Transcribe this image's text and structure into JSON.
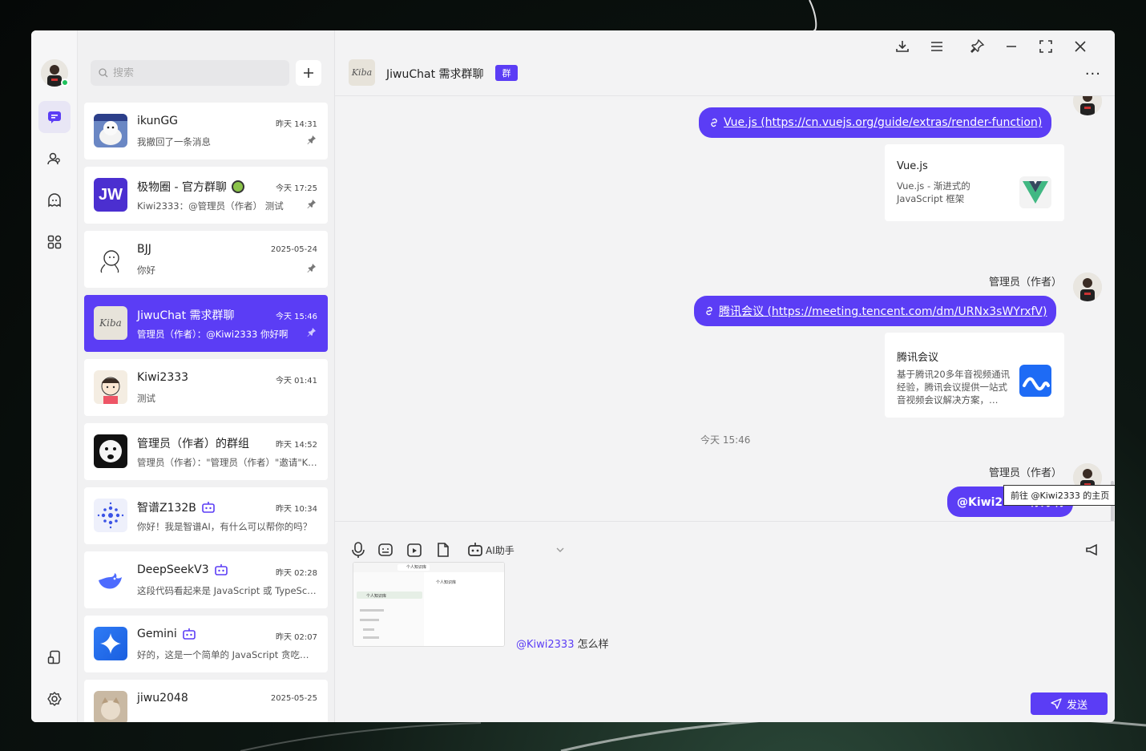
{
  "sidebar": {
    "status": "online"
  },
  "search": {
    "placeholder": "搜索"
  },
  "sessions": [
    {
      "name": "ikunGG",
      "time": "昨天 14:31",
      "preview": "我撤回了一条消息",
      "pinned": true
    },
    {
      "name": "极物圈 - 官方群聊",
      "time": "今天 17:25",
      "preview": "Kiwi2333：@管理员（作者） 测试",
      "pinned": true,
      "avatar_text": "JW"
    },
    {
      "name": "BJJ",
      "time": "2025-05-24",
      "preview": "你好",
      "pinned": true
    },
    {
      "name": "JiwuChat 需求群聊",
      "time": "今天 15:46",
      "preview": "管理员（作者）：@Kiwi2333 你好啊",
      "pinned": true,
      "active": true
    },
    {
      "name": "Kiwi2333",
      "time": "今天 01:41",
      "preview": "测试"
    },
    {
      "name": "管理员（作者）的群组",
      "time": "昨天 14:52",
      "preview": "管理员（作者）：\"管理员（作者）\"邀请\"Kiwi2333\"加入群聊"
    },
    {
      "name": "智谱Z132B",
      "time": "昨天 10:34",
      "preview": "你好！我是智谱AI，有什么可以帮你的吗？",
      "bot": true
    },
    {
      "name": "DeepSeekV3",
      "time": "昨天 02:28",
      "preview": "这段代码看起来是 JavaScript 或 TypeScript",
      "bot": true
    },
    {
      "name": "Gemini",
      "time": "昨天 02:07",
      "preview": "好的，这是一个简单的 JavaScript 贪吃蛇游戏",
      "bot": true
    },
    {
      "name": "jiwu2048",
      "time": "2025-05-25",
      "preview": ""
    }
  ],
  "chat": {
    "title": "JiwuChat 需求群聊",
    "badge": "群",
    "avatar_text": "Kiba",
    "more": "···"
  },
  "messages": {
    "link1": "Vue.js (https://cn.vuejs.org/guide/extras/render-function)",
    "card1": {
      "title": "Vue.js",
      "desc": "Vue.js - 渐进式的 JavaScript 框架"
    },
    "sender2": "管理员（作者）",
    "link2": "腾讯会议 (https://meeting.tencent.com/dm/URNx3sWYrxfV)",
    "card2": {
      "title": "腾讯会议",
      "desc": "基于腾讯20多年音视频通讯经验，腾讯会议提供一站式音视频会议解决方案，…"
    },
    "time_divider": "今天 15:46",
    "sender3": "管理员（作者）",
    "text3": "@Kiwi2333 你好啊",
    "tooltip": "前往 @Kiwi2333 的主页"
  },
  "composer": {
    "ai_label": "AI助手",
    "mention": "@Kiwi2333",
    "text": " 怎么样",
    "send_label": "发送",
    "screenshot": {
      "tab": "个人知识库",
      "sidebar_item": "个人知识库",
      "main_title": "个人知识库"
    }
  },
  "colors": {
    "accent": "#5b3df5",
    "online": "#1fc15c"
  }
}
